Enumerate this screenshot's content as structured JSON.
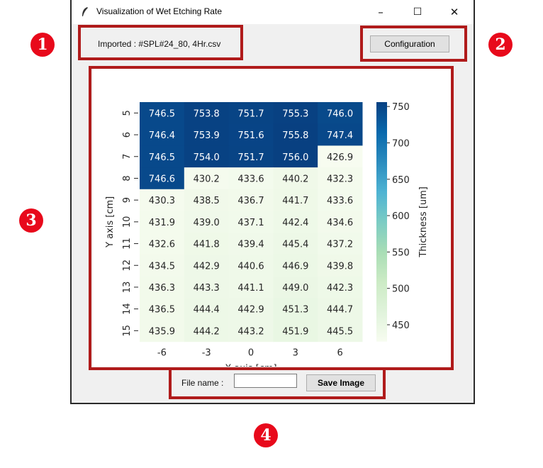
{
  "window": {
    "title": "Visualization of Wet Etching Rate",
    "minimize": "–",
    "maximize": "☐",
    "close": "✕"
  },
  "toolbar": {
    "imported_text": "Imported : #SPL#24_80, 4Hr.csv",
    "config_label": "Configuration"
  },
  "footer": {
    "file_label": "File name :",
    "file_value": "",
    "save_label": "Save Image"
  },
  "annotations": [
    "1",
    "2",
    "3",
    "4"
  ],
  "chart_data": {
    "type": "heatmap",
    "xlabel": "X axis [cm]",
    "ylabel": "Y axis [cm]",
    "x_ticks": [
      "-6",
      "-3",
      "0",
      "3",
      "6"
    ],
    "y_ticks": [
      "5",
      "6",
      "7",
      "8",
      "9",
      "10",
      "11",
      "12",
      "13",
      "14",
      "15"
    ],
    "values": [
      [
        746.5,
        753.8,
        751.7,
        755.3,
        746.0
      ],
      [
        746.4,
        753.9,
        751.6,
        755.8,
        747.4
      ],
      [
        746.5,
        754.0,
        751.7,
        756.0,
        426.9
      ],
      [
        746.6,
        430.2,
        433.6,
        440.2,
        432.3
      ],
      [
        430.3,
        438.5,
        436.7,
        441.7,
        433.6
      ],
      [
        431.9,
        439.0,
        437.1,
        442.4,
        434.6
      ],
      [
        432.6,
        441.8,
        439.4,
        445.4,
        437.2
      ],
      [
        434.5,
        442.9,
        440.6,
        446.9,
        439.8
      ],
      [
        436.3,
        443.3,
        441.1,
        449.0,
        442.3
      ],
      [
        436.5,
        444.4,
        442.9,
        451.3,
        444.7
      ],
      [
        435.9,
        444.2,
        443.2,
        451.9,
        445.5
      ]
    ],
    "colorbar": {
      "label": "Thickness [um]",
      "ticks": [
        750,
        700,
        650,
        600,
        550,
        500,
        450
      ],
      "range": [
        426.9,
        756.0
      ],
      "colormap": "GnBu",
      "colors": [
        "#f7fcf0",
        "#e0f3db",
        "#ccebc5",
        "#a8ddb5",
        "#7bccc4",
        "#4eb3d3",
        "#2b8cbe",
        "#0868ac",
        "#084081"
      ]
    }
  },
  "colors": {
    "annotation_red": "#b01b1b",
    "badge_red": "#e8091b"
  }
}
